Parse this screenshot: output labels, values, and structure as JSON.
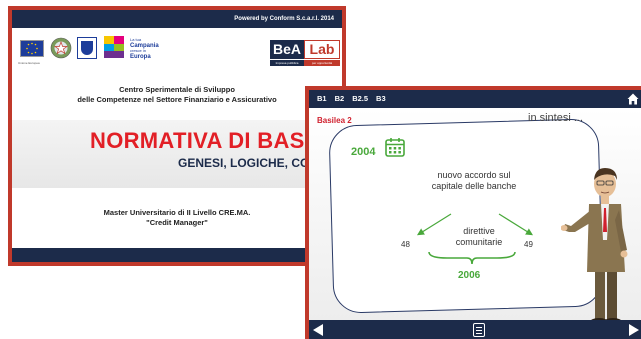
{
  "slide1": {
    "powered_by": "Powered by Conform S.c.a.r.l. 2014",
    "logos": {
      "eu_caption": "Unione Europea",
      "campania_pre": "La tua",
      "campania_name": "Campania",
      "campania_mid": "cresce in",
      "campania_europa": "Europa",
      "bea_left": "BeA",
      "bea_right": "Lab",
      "bea_sub_left": "Impresa pubblica",
      "bea_sub_right": "per opportunità"
    },
    "centro_line1": "Centro Sperimentale di Sviluppo",
    "centro_line2": "delle Competenze nel Settore Finanziario e Assicurativo",
    "title": "NORMATIVA DI BASI",
    "subtitle": "GENESI, LOGICHE, CONT",
    "master_line1": "Master Universitario di II Livello CRE.MA.",
    "master_line2": "\"Credit Manager\""
  },
  "slide2": {
    "tabs": [
      "B1",
      "B2",
      "B2.5",
      "B3"
    ],
    "section": "Basilea 2",
    "in_sintesi": "in sintesi ...",
    "year_start": "2004",
    "accordo": "nuovo accordo sul capitale delle banche",
    "direttive": "direttive comunitarie",
    "num_left": "48",
    "num_right": "49",
    "year_end": "2006"
  },
  "colors": {
    "navy": "#1c2b4a",
    "frame_red": "#c0392b",
    "title_red": "#e21f26",
    "green": "#49a83b"
  },
  "icons": [
    "home-icon",
    "calendar-icon",
    "nav-prev-icon",
    "menu-icon",
    "nav-next-icon"
  ]
}
